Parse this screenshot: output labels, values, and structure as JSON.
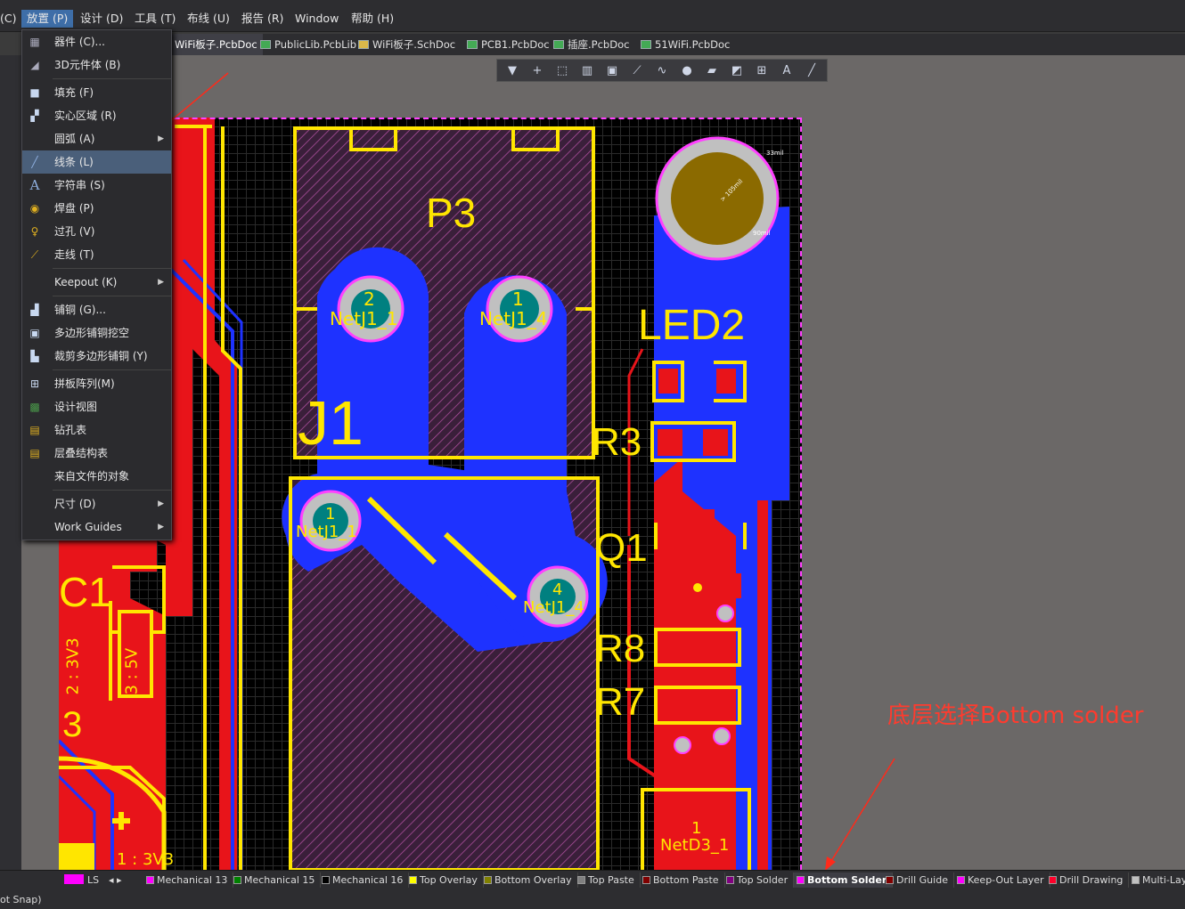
{
  "menubar": {
    "items": [
      {
        "label": "(C)"
      },
      {
        "label": "放置 (P)"
      },
      {
        "label": "设计 (D)"
      },
      {
        "label": "工具 (T)"
      },
      {
        "label": "布线 (U)"
      },
      {
        "label": "报告 (R)"
      },
      {
        "label": "Window"
      },
      {
        "label": "帮助 (H)"
      }
    ]
  },
  "tabs": [
    {
      "label": "WiFi板子.PcbDoc",
      "active": true
    },
    {
      "label": "PublicLib.PcbLib"
    },
    {
      "label": "WiFi板子.SchDoc"
    },
    {
      "label": "PCB1.PcbDoc"
    },
    {
      "label": "插座.PcbDoc"
    },
    {
      "label": "51WiFi.PcbDoc"
    }
  ],
  "place_menu": {
    "items": [
      {
        "label": "器件 (C)...",
        "icon": "component-icon"
      },
      {
        "label": "3D元件体 (B)",
        "icon": "3d-body-icon"
      },
      {
        "label": "填充 (F)",
        "icon": "fill-icon"
      },
      {
        "label": "实心区域 (R)",
        "icon": "solid-region-icon"
      },
      {
        "label": "圆弧 (A)",
        "icon": "arc-icon",
        "submenu": true
      },
      {
        "label": "线条 (L)",
        "icon": "line-icon",
        "selected": true
      },
      {
        "label": "字符串 (S)",
        "icon": "string-icon"
      },
      {
        "label": "焊盘 (P)",
        "icon": "pad-icon"
      },
      {
        "label": "过孔 (V)",
        "icon": "via-icon"
      },
      {
        "label": "走线 (T)",
        "icon": "track-icon"
      },
      {
        "label": "Keepout (K)",
        "submenu": true
      },
      {
        "label": "铺铜 (G)...",
        "icon": "polygon-pour-icon"
      },
      {
        "label": "多边形铺铜挖空",
        "icon": "polygon-cutout-icon"
      },
      {
        "label": "裁剪多边形铺铜 (Y)",
        "icon": "slice-polygon-icon"
      },
      {
        "label": "拼板阵列(M)",
        "icon": "embedded-board-array-icon"
      },
      {
        "label": "设计视图",
        "icon": "design-view-icon"
      },
      {
        "label": "钻孔表",
        "icon": "drill-table-icon"
      },
      {
        "label": "层叠结构表",
        "icon": "layer-stack-table-icon"
      },
      {
        "label": "来自文件的对象"
      },
      {
        "label": "尺寸 (D)",
        "submenu": true
      },
      {
        "label": "Work Guides",
        "submenu": true
      }
    ]
  },
  "pcb": {
    "labels": {
      "p3": "P3",
      "j1": "J1",
      "led2": "LED2",
      "r3": "R3",
      "q1": "Q1",
      "r8": "R8",
      "r7": "R7",
      "c1": "C1",
      "c3": "3",
      "pad2_num": "2",
      "pad2_net": "NetJ1_1",
      "pad1_num": "1",
      "pad1_net": "NetJ1_4",
      "pad1b_num": "1",
      "pad1b_net": "NetJ1_1",
      "pad4_num": "4",
      "pad4_net": "NetJ1_4",
      "d3_num": "1",
      "d3_net": "NetD3_1",
      "rot_3v3": "2 : 3V3",
      "rot_5v": "3 : 5V",
      "bottom_3v3": "1 : 3V3",
      "hole_dim1": "33mil",
      "hole_dim2": "> 105mil",
      "hole_dim3": "90mil"
    }
  },
  "annotation": {
    "text": "底层选择Bottom solder",
    "color": "#ff3b2e"
  },
  "layers": [
    {
      "label": "LS",
      "color": "#ff00ff"
    },
    {
      "label": "Mechanical 13",
      "color": "#ff00ff"
    },
    {
      "label": "Mechanical 15",
      "color": "#008000"
    },
    {
      "label": "Mechanical 16",
      "color": "#000000"
    },
    {
      "label": "Top Overlay",
      "color": "#ffff00"
    },
    {
      "label": "Bottom Overlay",
      "color": "#808000"
    },
    {
      "label": "Top Paste",
      "color": "#808080"
    },
    {
      "label": "Bottom Paste",
      "color": "#800000"
    },
    {
      "label": "Top Solder",
      "color": "#800080"
    },
    {
      "label": "Bottom Solder",
      "color": "#ff00ff",
      "active": true
    },
    {
      "label": "Drill Guide",
      "color": "#800000"
    },
    {
      "label": "Keep-Out Layer",
      "color": "#ff00ff"
    },
    {
      "label": "Drill Drawing",
      "color": "#ff002a"
    },
    {
      "label": "Multi-Lay",
      "color": "#c0c0c0"
    }
  ],
  "status": {
    "text": "ot Snap)"
  }
}
